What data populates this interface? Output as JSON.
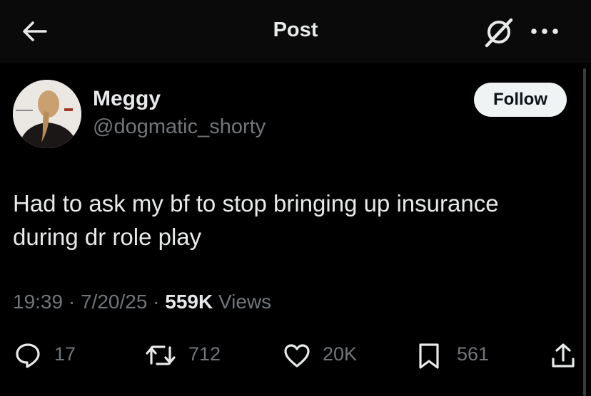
{
  "header": {
    "title": "Post"
  },
  "author": {
    "name": "Meggy",
    "handle": "@dogmatic_shorty",
    "follow_label": "Follow"
  },
  "tweet": {
    "lines": [
      "Had to ask my bf to stop bringing up insurance",
      "during dr role play"
    ],
    "time": "19:39",
    "date": "7/20/25",
    "views_count": "559K",
    "views_label": "Views"
  },
  "actions": {
    "replies": "17",
    "reposts": "712",
    "likes": "20K",
    "bookmarks": "561"
  },
  "icons": {
    "back": "arrow-left-icon",
    "grok": "grok-icon",
    "more": "more-horizontal-icon",
    "reply": "reply-icon",
    "repost": "repost-icon",
    "like": "heart-icon",
    "bookmark": "bookmark-icon",
    "share": "share-icon"
  },
  "colors": {
    "background": "#000000",
    "text": "#e7e9ea",
    "secondary": "#71767b",
    "follow_bg": "#eff3f4"
  }
}
